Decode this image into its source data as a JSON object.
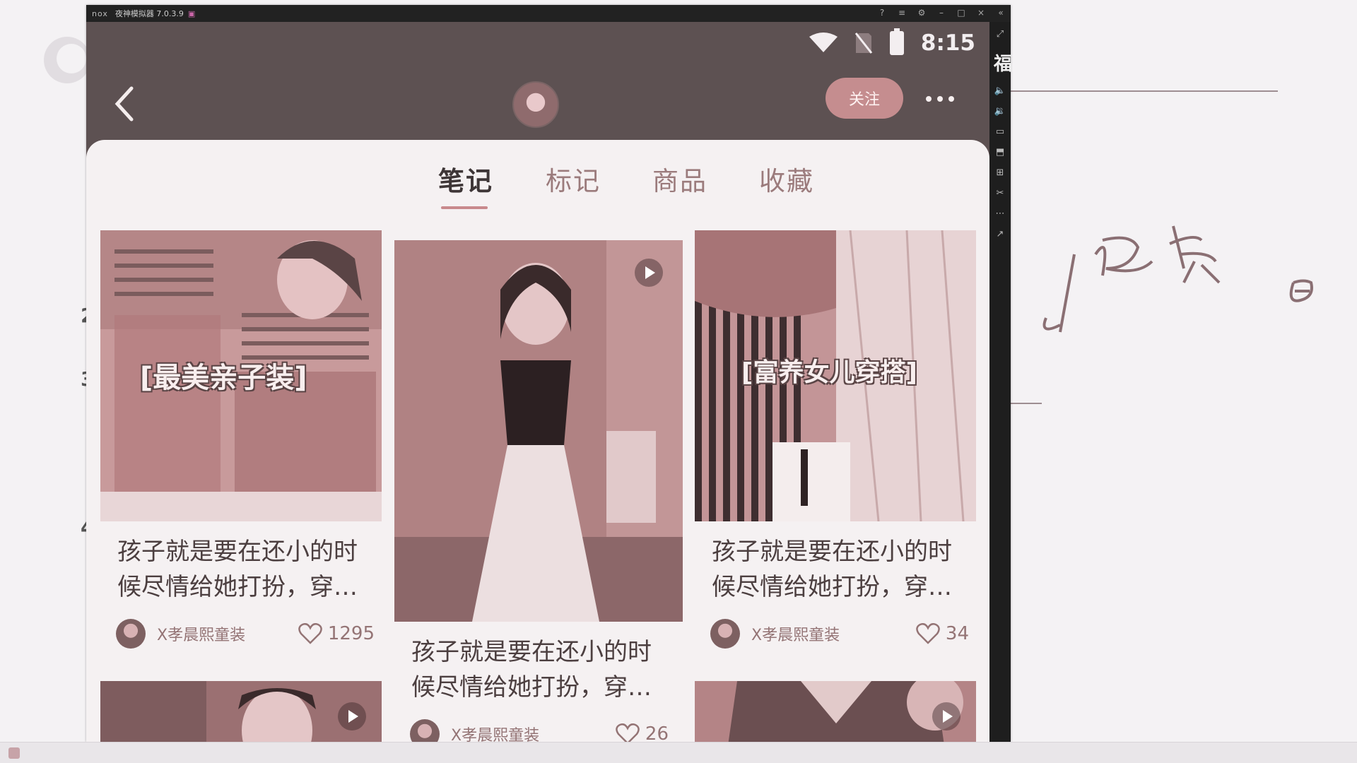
{
  "emulator": {
    "logo": "nox",
    "title": "夜神模拟器 7.0.3.9",
    "side_label": "福"
  },
  "status_bar": {
    "time": "8:15"
  },
  "header": {
    "follow_label": "关注"
  },
  "tabs": [
    {
      "label": "笔记",
      "active": true
    },
    {
      "label": "标记",
      "active": false
    },
    {
      "label": "商品",
      "active": false
    },
    {
      "label": "收藏",
      "active": false
    }
  ],
  "notes": [
    {
      "overlay": "[最美亲子装]",
      "title": "孩子就是要在还小的时候尽情给她打扮，穿…",
      "author": "X孝晨熙童装",
      "likes": "1295",
      "video": false
    },
    {
      "overlay": "",
      "title": "孩子就是要在还小的时候尽情给她打扮，穿…",
      "author": "X孝晨熙童装",
      "likes": "26",
      "video": true
    },
    {
      "overlay": "[富养女儿穿搭]",
      "title": "孩子就是要在还小的时候尽情给她打扮，穿…",
      "author": "X孝晨熙童装",
      "likes": "34",
      "video": false
    },
    {
      "overlay": "",
      "video": true
    },
    {
      "overlay": "",
      "video": true
    }
  ],
  "whiteboard": {
    "margin_marks": [
      "2",
      "3",
      "4"
    ]
  },
  "colors": {
    "header_bg": "#5d5152",
    "accent": "#c58d8f",
    "panel_bg": "#f5f1f2"
  }
}
